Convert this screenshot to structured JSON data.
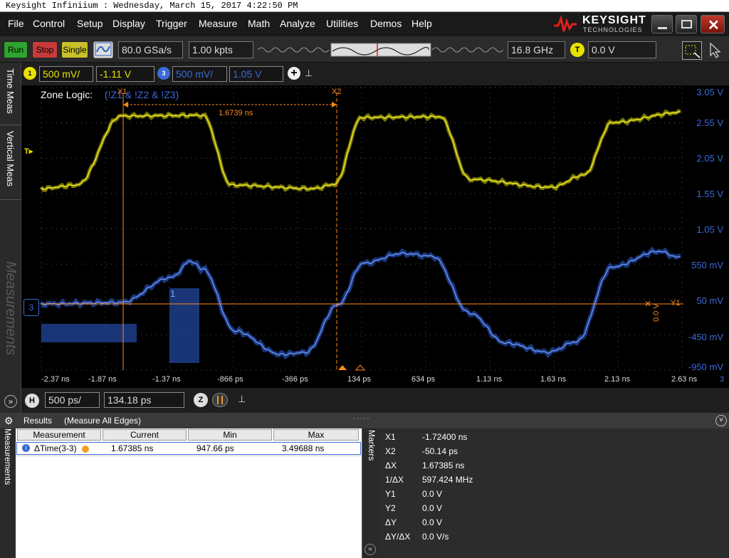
{
  "window": {
    "title": "Keysight Infiniium : Wednesday, March 15, 2017 4:22:50 PM"
  },
  "menu": {
    "items": [
      "File",
      "Control",
      "Setup",
      "Display",
      "Trigger",
      "Measure",
      "Math",
      "Analyze",
      "Utilities",
      "Demos",
      "Help"
    ]
  },
  "brand": {
    "name": "KEYSIGHT",
    "sub": "TECHNOLOGIES"
  },
  "toolbar": {
    "run_label": "Run",
    "stop_label": "Stop",
    "single_label": "Single",
    "sample_rate": "80.0 GSa/s",
    "memory_depth": "1.00 kpts",
    "bandwidth": "16.8 GHz",
    "trigger_channel": "T",
    "trigger_level": "0.0 V"
  },
  "channels": {
    "ch1": {
      "number": "1",
      "scale": "500 mV/",
      "offset": "-1.11 V",
      "color": "#e8e200"
    },
    "ch3": {
      "number": "3",
      "scale": "500 mV/",
      "offset": "1.05 V",
      "color": "#3a6ad8"
    }
  },
  "side_tabs": [
    "Time Meas",
    "Vertical Meas",
    "Measurements"
  ],
  "plot": {
    "zone_logic_label": "Zone Logic:",
    "zone_logic_expr": "(!Z1 & !Z2 & !Z3)",
    "delta_label": "1.6739 ns",
    "zone_label": "1",
    "cursor_x1": "X1",
    "cursor_x2": "X2",
    "cursor_y1": "Y1",
    "y_marker_value": "0.0 V",
    "channel_marker": "3",
    "y_axis_labels": [
      "3.05 V",
      "2.55 V",
      "2.05 V",
      "1.55 V",
      "1.05 V",
      "550 mV",
      "50 mV",
      "-450 mV",
      "-950 mV"
    ],
    "x_axis_labels": [
      "-2.37 ns",
      "-1.87 ns",
      "-1.37 ns",
      "-866 ps",
      "-366 ps",
      "134 ps",
      "634 ps",
      "1.13 ns",
      "1.63 ns",
      "2.13 ns",
      "2.63 ns"
    ],
    "x_axis_end": "3"
  },
  "timebase": {
    "h_label": "H",
    "scale": "500 ps/",
    "position": "134.18 ps"
  },
  "results": {
    "title": "Results",
    "subtitle": "(Measure All Edges)",
    "side_label": "Measurements"
  },
  "table": {
    "headers": [
      "Measurement",
      "Current",
      "Min",
      "Max"
    ],
    "rows": [
      {
        "name": "ΔTime(3-3)",
        "current": "1.67385 ns",
        "min": "947.66 ps",
        "max": "3.49688 ns"
      }
    ]
  },
  "markers": {
    "side_label": "Markers",
    "rows": [
      {
        "label": "X1",
        "value": "-1.72400 ns"
      },
      {
        "label": "X2",
        "value": "-50.14 ps"
      },
      {
        "label": "ΔX",
        "value": "1.67385 ns"
      },
      {
        "label": "1/ΔX",
        "value": "597.424 MHz"
      },
      {
        "label": "Y1",
        "value": "0.0 V"
      },
      {
        "label": "Y2",
        "value": "0.0 V"
      },
      {
        "label": "ΔY",
        "value": "0.0 V"
      },
      {
        "label": "ΔY/ΔX",
        "value": "0.0 V/s"
      }
    ]
  }
}
